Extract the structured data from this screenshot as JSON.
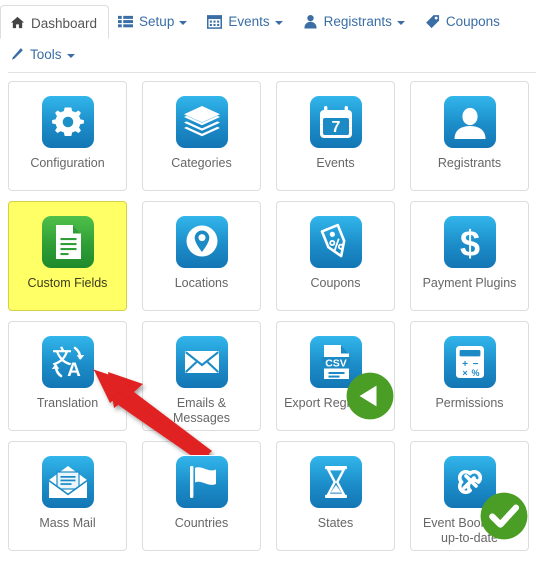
{
  "navbar": {
    "row1": [
      {
        "label": "Dashboard",
        "icon": "home-icon",
        "active": true,
        "caret": false
      },
      {
        "label": "Setup",
        "icon": "list-icon",
        "active": false,
        "caret": true
      },
      {
        "label": "Events",
        "icon": "calendar-icon",
        "active": false,
        "caret": true
      },
      {
        "label": "Registrants",
        "icon": "user-icon",
        "active": false,
        "caret": true
      },
      {
        "label": "Coupons",
        "icon": "tag-icon",
        "active": false,
        "caret": false
      }
    ],
    "row2": [
      {
        "label": "Tools",
        "icon": "wrench-icon",
        "active": false,
        "caret": true
      }
    ]
  },
  "grid": {
    "rows": [
      [
        {
          "label": "Configuration",
          "icon": "gear-icon",
          "highlight": false,
          "badge": ""
        },
        {
          "label": "Categories",
          "icon": "layers-icon",
          "highlight": false,
          "badge": ""
        },
        {
          "label": "Events",
          "icon": "calendar-7-icon",
          "highlight": false,
          "badge": ""
        },
        {
          "label": "Registrants",
          "icon": "person-icon",
          "highlight": false,
          "badge": ""
        }
      ],
      [
        {
          "label": "Custom Fields",
          "icon": "document-icon",
          "highlight": true,
          "badge": ""
        },
        {
          "label": "Locations",
          "icon": "map-pin-icon",
          "highlight": false,
          "badge": ""
        },
        {
          "label": "Coupons",
          "icon": "percent-tag-icon",
          "highlight": false,
          "badge": ""
        },
        {
          "label": "Payment Plugins",
          "icon": "dollar-icon",
          "highlight": false,
          "badge": ""
        }
      ],
      [
        {
          "label": "Translation",
          "icon": "translate-icon",
          "highlight": false,
          "badge": ""
        },
        {
          "label": "Emails & Messages",
          "icon": "envelope-icon",
          "highlight": false,
          "badge": ""
        },
        {
          "label": "Export Registrants",
          "icon": "csv-file-icon",
          "highlight": false,
          "badge": "green-left-arrow"
        },
        {
          "label": "Permissions",
          "icon": "calculator-icon",
          "highlight": false,
          "badge": ""
        }
      ],
      [
        {
          "label": "Mass Mail",
          "icon": "open-envelope-icon",
          "highlight": false,
          "badge": ""
        },
        {
          "label": "Countries",
          "icon": "flag-icon",
          "highlight": false,
          "badge": ""
        },
        {
          "label": "States",
          "icon": "hourglass-icon",
          "highlight": false,
          "badge": ""
        },
        {
          "label": "Event Booking is up-to-date",
          "icon": "joomla-icon",
          "highlight": false,
          "badge": "green-check"
        }
      ]
    ]
  },
  "annotation": {
    "arrow_color": "#e02020",
    "arrow_points_to": "Custom Fields"
  },
  "colors": {
    "link": "#3a6ea5",
    "tile_icon_top": "#32b6ec",
    "tile_icon_bottom": "#1376b4",
    "highlight_bg": "#ffff66",
    "green_icon": "#2f9e36",
    "label_text": "#666666"
  }
}
